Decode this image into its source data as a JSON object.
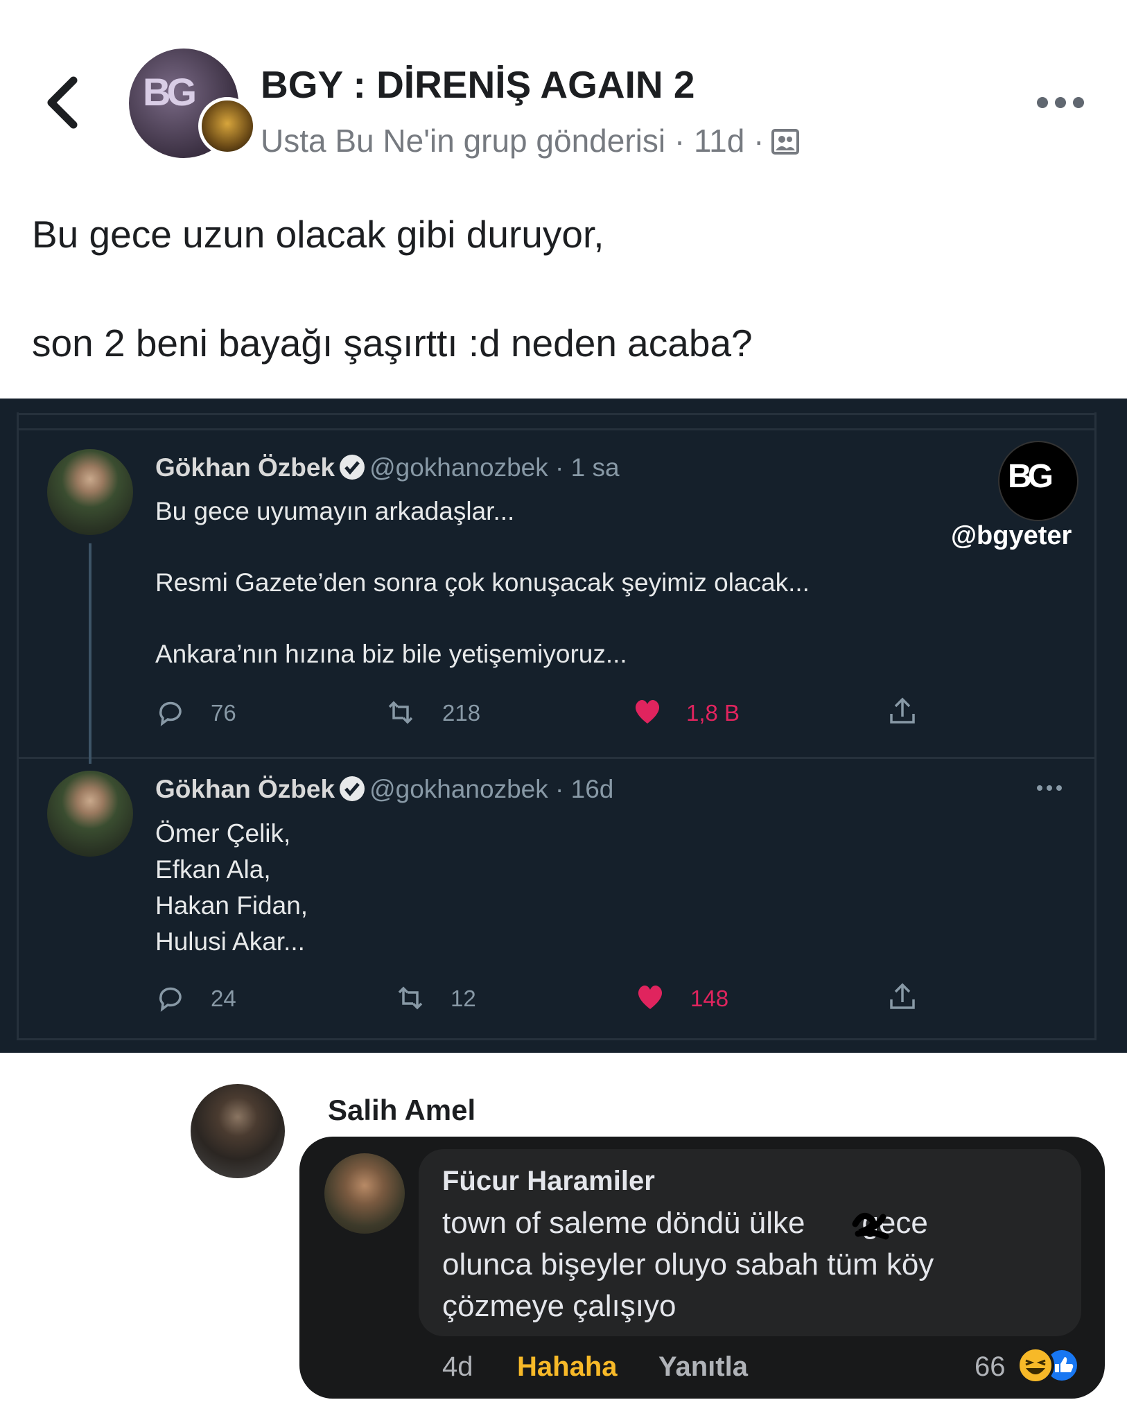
{
  "header": {
    "group_name": "BGY : DİRENİŞ AGAIN 2",
    "subtitle": "Usta Bu Ne'in grup gönderisi · 11d ·",
    "back_icon": "chevron-left-icon",
    "more_icon": "more-dots-icon"
  },
  "post": {
    "line1": "Bu gece uzun olacak gibi duruyor,",
    "line2": "son 2 beni bayağı şaşırttı :d neden acaba?"
  },
  "tweets": [
    {
      "name": "Gökhan Özbek",
      "handle": "@gokhanozbek · 1 sa",
      "lines": [
        "Bu gece uyumayın arkadaşlar...",
        "Resmi Gazete’den sonra çok konuşacak şeyimiz olacak...",
        "Ankara’nın hızına biz bile yetişemiyoruz..."
      ],
      "replies": "76",
      "retweets": "218",
      "likes": "1,8 B"
    },
    {
      "name": "Gökhan Özbek",
      "handle": "@gokhanozbek · 16d",
      "lines": [
        "Ömer Çelik,",
        "Efkan Ala,",
        "Hakan Fidan,",
        "Hulusi Akar..."
      ],
      "replies": "24",
      "retweets": "12",
      "likes": "148"
    }
  ],
  "watermark": "@bgyeter",
  "comment": {
    "author": "Salih Amel",
    "quoted_author": "Fücur Haramiler",
    "quoted_lines": [
      "town of saleme döndü ülke",
      "gece",
      "olunca bişeyler oluyo sabah tüm köy",
      "çözmeye çalışıyo"
    ],
    "time": "4d",
    "reaction": "Hahaha",
    "reply": "Yanıtla",
    "reaction_count": "66"
  },
  "colors": {
    "tweet_bg": "#15202b",
    "like": "#e0245e",
    "haha": "#f7b928",
    "comment_bg": "#18191a"
  }
}
